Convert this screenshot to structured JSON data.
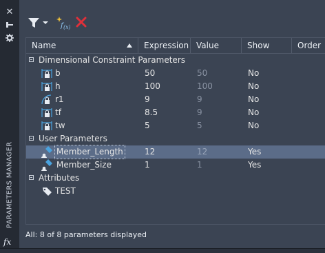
{
  "window": {
    "title": "PARAMETERS MANAGER",
    "fx_label": "fx"
  },
  "toolbar": {
    "filter_icon": "filter-icon",
    "new_user_param_icon": "new-user-parameter-icon",
    "delete_icon": "delete-icon"
  },
  "columns": [
    "Name",
    "Expression",
    "Value",
    "Show",
    "Order"
  ],
  "groups": [
    {
      "label": "Dimensional Constraint Parameters",
      "rows": [
        {
          "name": "b",
          "expression": "50",
          "value": "50",
          "show": "No",
          "icon": "linear-dimension-lock-icon"
        },
        {
          "name": "h",
          "expression": "100",
          "value": "100",
          "show": "No",
          "icon": "linear-dimension-lock-icon"
        },
        {
          "name": "r1",
          "expression": "9",
          "value": "9",
          "show": "No",
          "icon": "radius-dimension-lock-icon"
        },
        {
          "name": "tf",
          "expression": "8.5",
          "value": "9",
          "show": "No",
          "icon": "linear-dimension-lock-icon"
        },
        {
          "name": "tw",
          "expression": "5",
          "value": "5",
          "show": "No",
          "icon": "linear-dimension-lock-icon"
        }
      ]
    },
    {
      "label": "User Parameters",
      "rows": [
        {
          "name": "Member_Length",
          "expression": "12",
          "value": "12",
          "show": "Yes",
          "icon": "user-parameter-icon",
          "selected": true
        },
        {
          "name": "Member_Size",
          "expression": "1",
          "value": "1",
          "show": "Yes",
          "icon": "user-parameter-icon"
        }
      ]
    },
    {
      "label": "Attributes",
      "rows": [
        {
          "name": "TEST",
          "expression": "",
          "value": "",
          "show": "",
          "icon": "attribute-tag-icon"
        }
      ]
    }
  ],
  "status": "All: 8 of 8 parameters displayed",
  "colors": {
    "background": "#3b4453",
    "selected_row": "#5b6c88",
    "delete_red": "#e0303a",
    "sparkle_yellow": "#f2c23a",
    "icon_blue": "#4aa3df"
  }
}
